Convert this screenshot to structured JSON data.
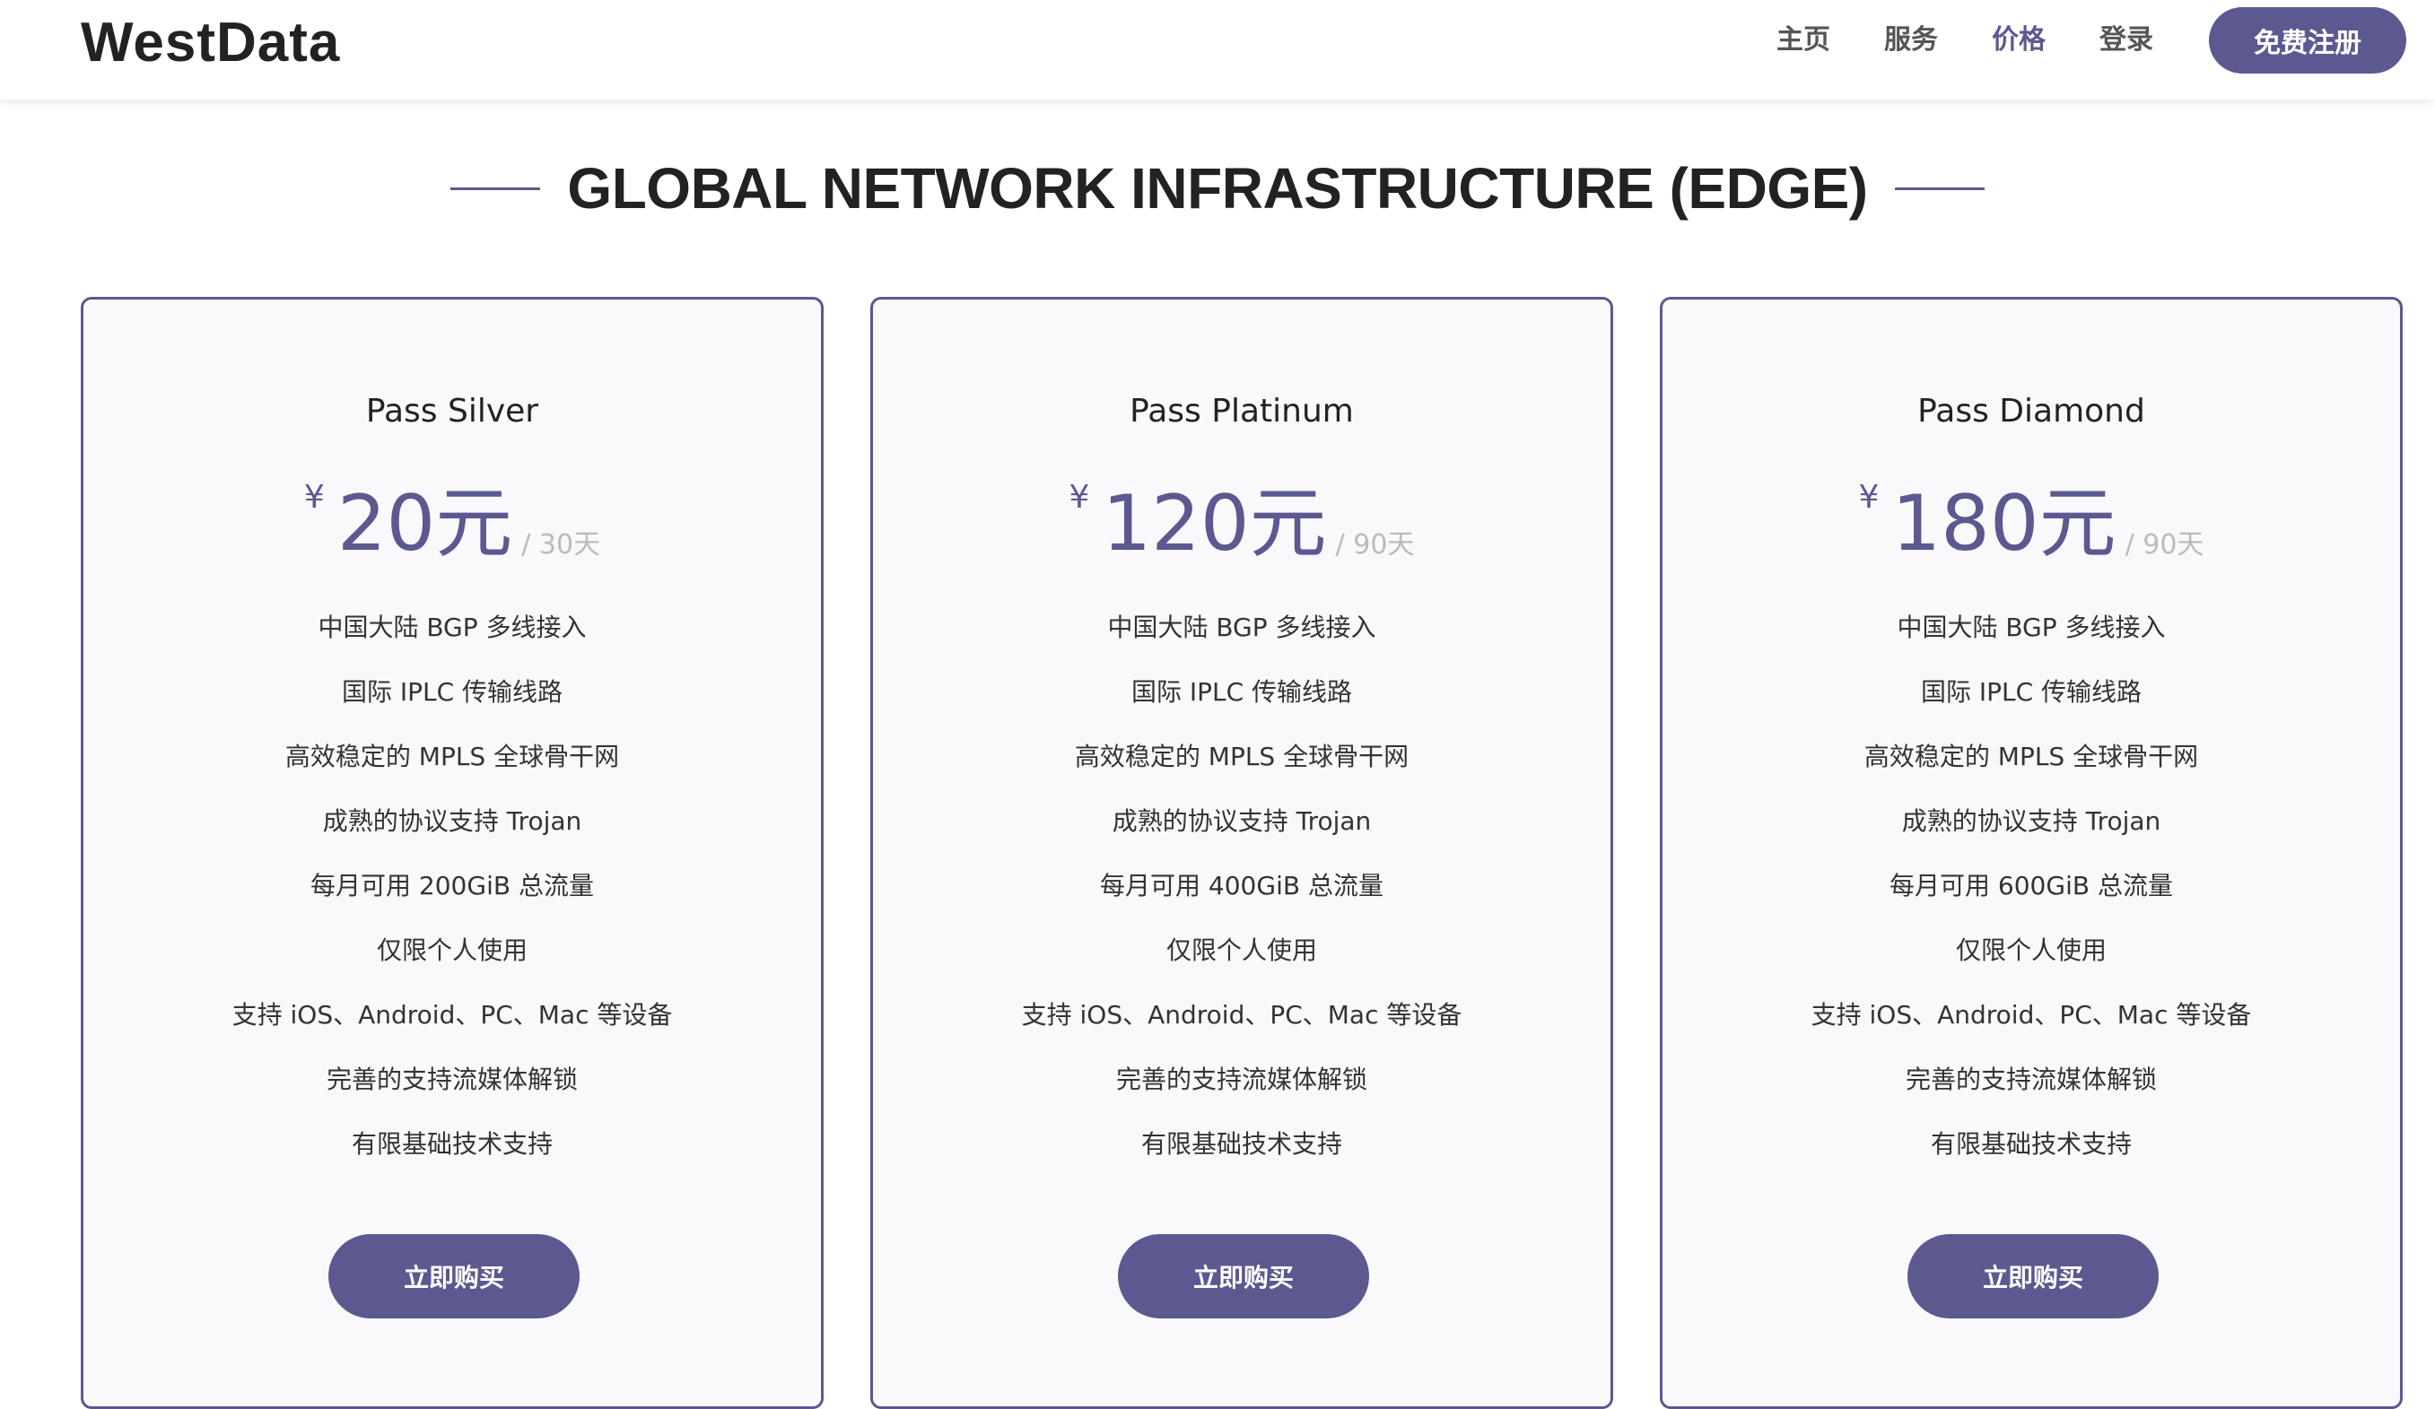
{
  "brand": "WestData",
  "nav": {
    "home": "主页",
    "services": "服务",
    "pricing": "价格",
    "login": "登录",
    "signup": "免费注册"
  },
  "section_title": "GLOBAL NETWORK INFRASTRUCTURE (EDGE)",
  "colors": {
    "accent": "#5c5890",
    "card_bg": "#f9f9fb",
    "muted": "#bbbbbb"
  },
  "plans": [
    {
      "name": "Pass Silver",
      "currency": "¥",
      "price": "20元",
      "period": "/ 30天",
      "features": [
        "中国大陆 BGP 多线接入",
        "国际 IPLC 传输线路",
        "高效稳定的 MPLS 全球骨干网",
        "成熟的协议支持 Trojan",
        "每月可用 200GiB 总流量",
        "仅限个人使用",
        "支持 iOS、Android、PC、Mac 等设备",
        "完善的支持流媒体解锁",
        "有限基础技术支持"
      ],
      "cta": "立即购买"
    },
    {
      "name": "Pass Platinum",
      "currency": "¥",
      "price": "120元",
      "period": "/ 90天",
      "features": [
        "中国大陆 BGP 多线接入",
        "国际 IPLC 传输线路",
        "高效稳定的 MPLS 全球骨干网",
        "成熟的协议支持 Trojan",
        "每月可用 400GiB 总流量",
        "仅限个人使用",
        "支持 iOS、Android、PC、Mac 等设备",
        "完善的支持流媒体解锁",
        "有限基础技术支持"
      ],
      "cta": "立即购买"
    },
    {
      "name": "Pass Diamond",
      "currency": "¥",
      "price": "180元",
      "period": "/ 90天",
      "features": [
        "中国大陆 BGP 多线接入",
        "国际 IPLC 传输线路",
        "高效稳定的 MPLS 全球骨干网",
        "成熟的协议支持 Trojan",
        "每月可用 600GiB 总流量",
        "仅限个人使用",
        "支持 iOS、Android、PC、Mac 等设备",
        "完善的支持流媒体解锁",
        "有限基础技术支持"
      ],
      "cta": "立即购买"
    }
  ]
}
